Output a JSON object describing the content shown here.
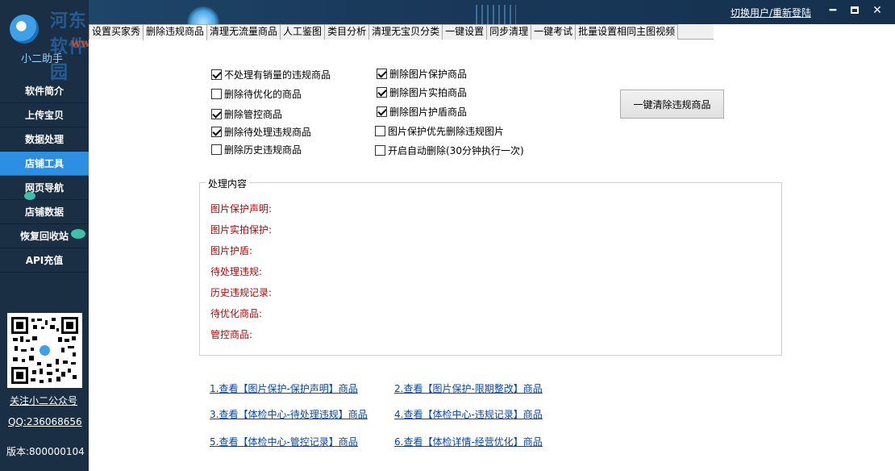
{
  "watermark": {
    "site": "河东软件园",
    "url": "www.pc0359.cn"
  },
  "app": {
    "logo_text": "小二助手"
  },
  "titlebar": {
    "switch_user": "切换用户/重新登陆",
    "minimize": "━",
    "close": "✕"
  },
  "sidebar": {
    "items": [
      {
        "label": "软件简介"
      },
      {
        "label": "上传宝贝"
      },
      {
        "label": "数据处理"
      },
      {
        "label": "店铺工具",
        "active": true
      },
      {
        "label": "网页导航"
      },
      {
        "label": "店铺数据"
      },
      {
        "label": "恢复回收站"
      },
      {
        "label": "API充值"
      }
    ],
    "follow_link": "关注小二公众号",
    "qq": "QQ:236068656",
    "version": "版本:800000104"
  },
  "tabs": [
    {
      "label": "设置买家秀"
    },
    {
      "label": "删除违规商品",
      "active": true
    },
    {
      "label": "清理无流量商品"
    },
    {
      "label": "人工鉴图"
    },
    {
      "label": "类目分析"
    },
    {
      "label": "清理无宝贝分类"
    },
    {
      "label": "一键设置"
    },
    {
      "label": "同步清理"
    },
    {
      "label": "一键考试"
    },
    {
      "label": "批量设置相同主图视频"
    }
  ],
  "options": {
    "left": [
      {
        "label": "不处理有销量的违规商品",
        "checked": true
      },
      {
        "label": "删除待优化的商品",
        "checked": false
      },
      {
        "label": "删除管控商品",
        "checked": true
      },
      {
        "label": "删除待处理违规商品",
        "checked": true
      },
      {
        "label": "删除历史违规商品",
        "checked": false
      }
    ],
    "right": [
      {
        "label": "删除图片保护商品",
        "checked": true
      },
      {
        "label": "删除图片实拍商品",
        "checked": true
      },
      {
        "label": "删除图片护盾商品",
        "checked": true
      },
      {
        "label": "图片保护优先删除违规图片",
        "checked": false
      },
      {
        "label": "开启自动删除(30分钟执行一次)",
        "checked": false
      }
    ]
  },
  "clear_button": "一键清除违规商品",
  "process": {
    "legend": "处理内容",
    "rows": [
      "图片保护声明:",
      "图片实拍保护:",
      "图片护盾:",
      "待处理违规:",
      "历史违规记录:",
      "待优化商品:",
      "管控商品:"
    ]
  },
  "links": [
    "1.查看【图片保护-保护声明】商品",
    "2.查看【图片保护-限期整改】商品",
    "3.查看【体检中心-待处理违规】商品",
    "4.查看【体检中心-违规记录】商品",
    "5.查看【体检中心-管控记录】商品",
    "6.查看【体检详情-经营优化】商品"
  ]
}
